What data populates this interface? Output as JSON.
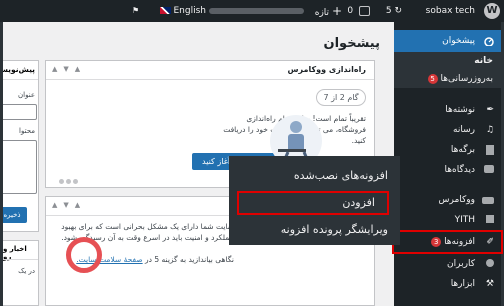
{
  "adminbar": {
    "site_name": "sobax tech",
    "updates_count": "5",
    "comments_count": "0",
    "new_label": "تازه",
    "language": "English"
  },
  "sidebar": {
    "dashboard": "پیشخوان",
    "home": "خانه",
    "updates": "به‌روزرسانی‌ها",
    "updates_badge": "5",
    "posts": "نوشته‌ها",
    "media": "رسانه",
    "pages": "برگه‌ها",
    "comments": "دیدگاه‌ها",
    "woocommerce": "ووکامرس",
    "yith": "YITH",
    "plugins": "افزونه‌ها",
    "plugins_badge": "3",
    "users": "کاربران",
    "tools": "ابزارها"
  },
  "main": {
    "page_title": "پیشخوان",
    "setup_box": {
      "title": "راه‌اندازی ووکامرس",
      "step": "گام 2 از 7",
      "text": "تقریباً تمام است! برای اتمام راه‌اندازی فروشگاه، می توانید سفارشات خود را دریافت کنید.",
      "button": "فروشستان را آغاز کنید"
    },
    "health_box": {
      "text": "سایت شما دارای یک مشکل بحرانی است که برای بهبود عملکرد و امنیت باید در اسرع وقت به آن رسیدگی شود.",
      "footer_text": "نگاهی بیاندازید به گزینه 5 در",
      "footer_link": "صفحهٔ سلامت سایت."
    },
    "left_column": {
      "box1_title": "پیش‌نویس",
      "field1": "عنوان",
      "field2": "محتوا",
      "button": "ذخیره",
      "box2_title": "اخبار و رو",
      "text": "در یک"
    }
  },
  "flyout": {
    "installed": "افزونه‌های نصب‌شده",
    "add_new": "افزودن",
    "editor": "ویرایشگر پرونده افزونه"
  }
}
